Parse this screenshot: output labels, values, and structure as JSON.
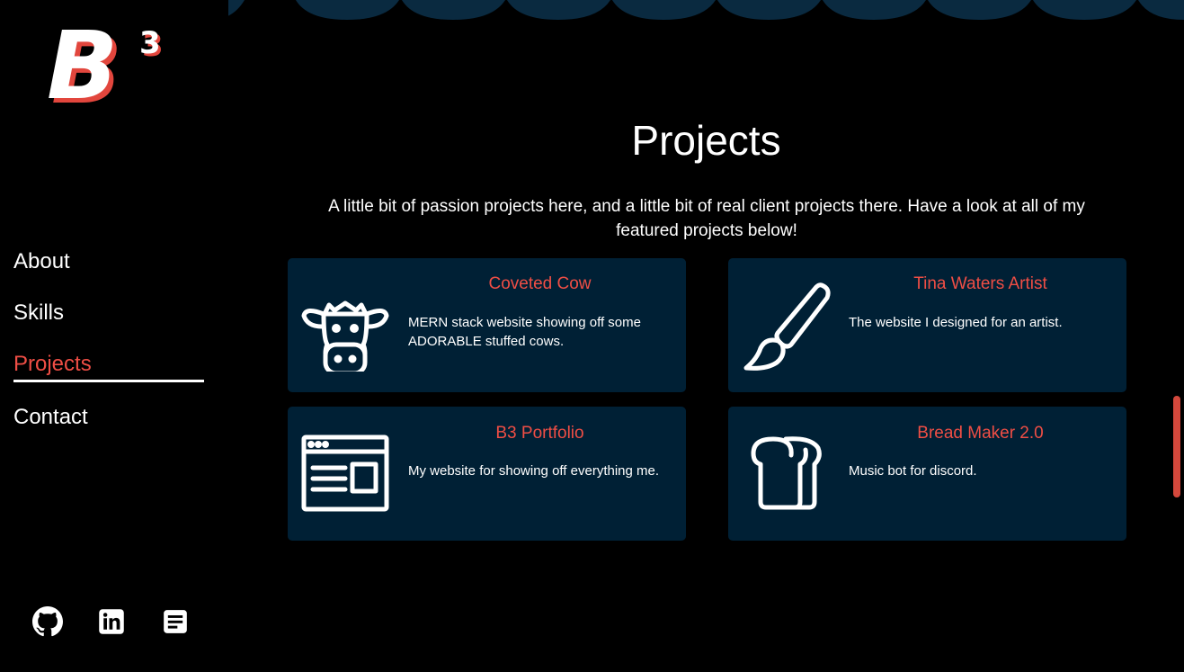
{
  "logo": {
    "letter": "B",
    "superscript": "3"
  },
  "nav": {
    "items": [
      {
        "label": "About"
      },
      {
        "label": "Skills"
      },
      {
        "label": "Projects",
        "active": true
      },
      {
        "label": "Contact"
      }
    ]
  },
  "socials": [
    {
      "icon": "github-icon"
    },
    {
      "icon": "linkedin-icon"
    },
    {
      "icon": "resume-icon"
    }
  ],
  "main": {
    "title": "Projects",
    "intro": "A little bit of passion projects here, and a little bit of real client projects there. Have a look at all of my featured projects below!",
    "projects": [
      {
        "title": "Coveted Cow",
        "description": "MERN stack website showing off some ADORABLE stuffed cows.",
        "icon": "cow-icon"
      },
      {
        "title": "Tina Waters Artist",
        "description": "The website I designed for an artist.",
        "icon": "paintbrush-icon"
      },
      {
        "title": "B3 Portfolio",
        "description": "My website for showing off everything me.",
        "icon": "browser-window-icon"
      },
      {
        "title": "Bread Maker 2.0",
        "description": "Music bot for discord.",
        "icon": "bread-icon"
      }
    ]
  },
  "colors": {
    "background": "#000000",
    "accent": "#ef4e45",
    "card": "#002035",
    "wave": "#0a2a40"
  }
}
